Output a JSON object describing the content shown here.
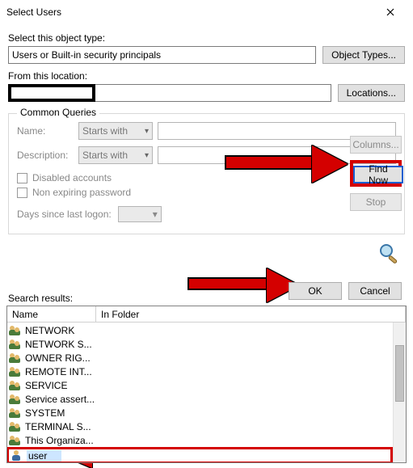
{
  "window": {
    "title": "Select Users"
  },
  "labels": {
    "object_type": "Select this object type:",
    "from_location": "From this location:",
    "common_queries": "Common Queries",
    "name": "Name:",
    "description": "Description:",
    "disabled_accounts": "Disabled accounts",
    "non_expiring": "Non expiring password",
    "days_since": "Days since last logon:",
    "search_results": "Search results:"
  },
  "fields": {
    "object_type_value": "Users or Built-in security principals",
    "location_value": "",
    "name_match": "Starts with",
    "name_value": "",
    "desc_match": "Starts with",
    "desc_value": ""
  },
  "buttons": {
    "object_types": "Object Types...",
    "locations": "Locations...",
    "columns": "Columns...",
    "find_now": "Find Now",
    "stop": "Stop",
    "ok": "OK",
    "cancel": "Cancel"
  },
  "results": {
    "headers": {
      "name": "Name",
      "in_folder": "In Folder"
    },
    "rows": [
      {
        "icon": "group",
        "name": "NETWORK"
      },
      {
        "icon": "group",
        "name": "NETWORK S..."
      },
      {
        "icon": "group",
        "name": "OWNER RIG..."
      },
      {
        "icon": "group",
        "name": "REMOTE INT..."
      },
      {
        "icon": "group",
        "name": "SERVICE"
      },
      {
        "icon": "group",
        "name": "Service assert..."
      },
      {
        "icon": "group",
        "name": "SYSTEM"
      },
      {
        "icon": "group",
        "name": "TERMINAL S..."
      },
      {
        "icon": "group",
        "name": "This Organiza..."
      },
      {
        "icon": "user",
        "name": "user",
        "selected": true
      }
    ]
  }
}
